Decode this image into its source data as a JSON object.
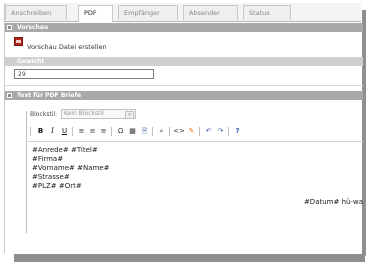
{
  "tabs": [
    {
      "label": "Anschreiben",
      "active": false
    },
    {
      "label": "PDF",
      "active": true
    },
    {
      "label": "Empfänger",
      "active": false
    },
    {
      "label": "Absender",
      "active": false
    },
    {
      "label": "Status",
      "active": false
    }
  ],
  "preview": {
    "section_title": "Vorschau",
    "icon": "pdf-icon",
    "link_label": "Vorschau Datei erstellen"
  },
  "weight": {
    "label": "Gewicht",
    "value": "29"
  },
  "text_section": {
    "title": "Text für PDF Briefe",
    "blockstil_label": "Blockstil:",
    "blockstil_value": "Kein Blockstil",
    "toolbar": [
      "B",
      "I",
      "U",
      "≡",
      "≡",
      "≡",
      "Ω",
      "▦",
      "🗎",
      "⌕",
      "<>",
      "✎",
      "↶",
      "↷",
      "?"
    ]
  },
  "editor": {
    "lines": [
      "#Anrede# #Titel#",
      "#Firma#",
      "#Vorname# #Name#",
      "#Strasse#",
      "#PLZ# #Ort#"
    ],
    "date_line": "#Datum# hü-wa"
  },
  "colors": {
    "header_bar": "#a9a9a9",
    "sub_bar": "#cfcfcf",
    "pdf_icon": "#b3261e",
    "help_icon": "#3a5ea8"
  }
}
